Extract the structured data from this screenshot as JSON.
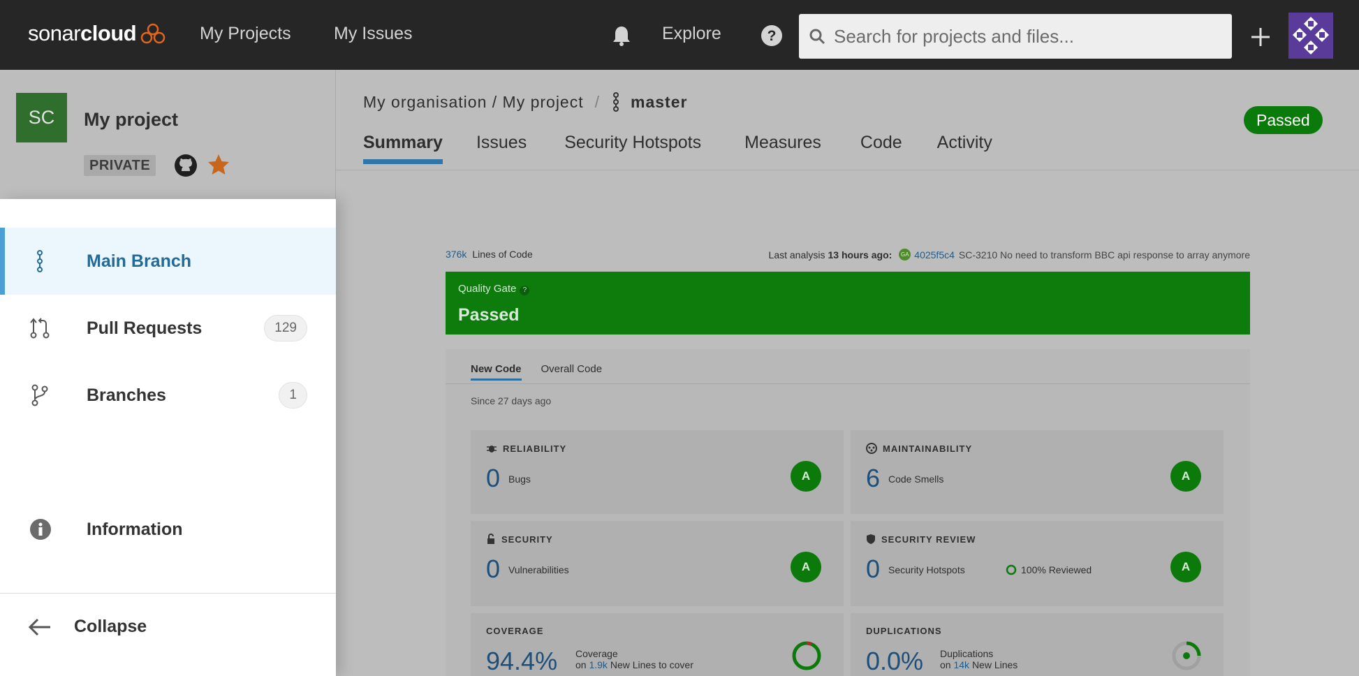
{
  "topnav": {
    "logo_light": "sonar",
    "logo_bold": "cloud",
    "links": [
      "My Projects",
      "My Issues"
    ],
    "explore": "Explore",
    "search_placeholder": "Search for projects and files..."
  },
  "project": {
    "avatar_initials": "SC",
    "name": "My project",
    "visibility": "PRIVATE",
    "breadcrumb": "My organisation / My project",
    "branch": "master",
    "quality_status": "Passed",
    "tabs": [
      "Summary",
      "Issues",
      "Security Hotspots",
      "Measures",
      "Code",
      "Activity"
    ]
  },
  "summary": {
    "loc_value": "376k",
    "loc_label": "Lines of Code",
    "last_analysis_prefix": "Last analysis",
    "last_analysis_time": "13 hours ago:",
    "commit_badge": "GA",
    "commit_hash": "4025f5c4",
    "commit_message": "SC-3210 No need to transform BBC api response to array anymore",
    "quality_gate_label": "Quality Gate",
    "quality_gate_help": "?",
    "quality_gate_value": "Passed",
    "code_tabs": [
      "New Code",
      "Overall Code"
    ],
    "since": "Since 27 days ago",
    "cards": {
      "reliability": {
        "title": "RELIABILITY",
        "value": "0",
        "label": "Bugs",
        "rating": "A"
      },
      "maintainability": {
        "title": "MAINTAINABILITY",
        "value": "6",
        "label": "Code Smells",
        "rating": "A"
      },
      "security": {
        "title": "SECURITY",
        "value": "0",
        "label": "Vulnerabilities",
        "rating": "A"
      },
      "security_review": {
        "title": "SECURITY REVIEW",
        "value": "0",
        "label": "Security Hotspots",
        "reviewed": "100% Reviewed",
        "rating": "A"
      },
      "coverage": {
        "title": "COVERAGE",
        "value": "94.4%",
        "label": "Coverage",
        "sub_prefix": "on",
        "sub_link": "1.9k",
        "sub_suffix": "New Lines to cover"
      },
      "duplications": {
        "title": "DUPLICATIONS",
        "value": "0.0%",
        "label": "Duplications",
        "sub_prefix": "on",
        "sub_link": "14k",
        "sub_suffix": "New Lines"
      }
    }
  },
  "panel": {
    "items": [
      {
        "label": "Main Branch",
        "icon": "branch-icon"
      },
      {
        "label": "Pull Requests",
        "count": "129",
        "icon": "pull-request-icon"
      },
      {
        "label": "Branches",
        "count": "1",
        "icon": "branches-icon"
      },
      {
        "label": "Information",
        "icon": "info-icon"
      }
    ],
    "collapse": "Collapse"
  },
  "colors": {
    "topbar": "#262626",
    "passed_green": "#0a7a0a",
    "active_blue": "#4b9fd5",
    "active_bg": "#ecf6fd"
  }
}
